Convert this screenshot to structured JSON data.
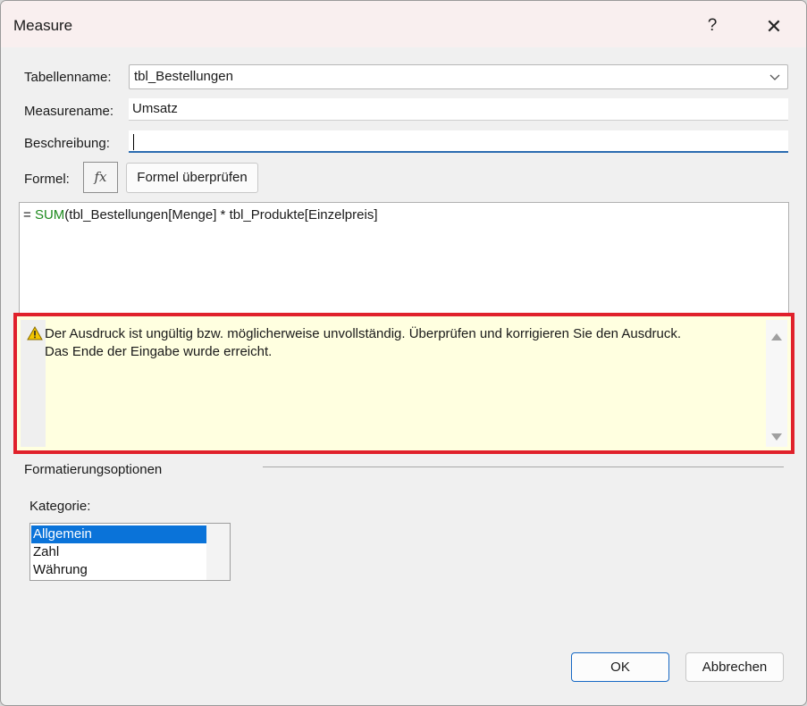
{
  "window": {
    "title": "Measure",
    "help_glyph": "?",
    "close_glyph": "✕"
  },
  "form": {
    "table_label": "Tabellenname:",
    "table_value": "tbl_Bestellungen",
    "measure_label": "Measurename:",
    "measure_value": "Umsatz",
    "description_label": "Beschreibung:",
    "description_value": "",
    "formula_label": "Formel:",
    "fx_label": "fx",
    "check_formula_button": "Formel überprüfen"
  },
  "formula": {
    "prefix": "= ",
    "function": "SUM",
    "rest": "(tbl_Bestellungen[Menge] * tbl_Produkte[Einzelpreis]"
  },
  "error": {
    "icon": "warning-icon",
    "line1": "Der Ausdruck ist ungültig bzw. möglicherweise unvollständig. Überprüfen und korrigieren Sie den Ausdruck.",
    "line2": "Das Ende der Eingabe wurde erreicht.",
    "highlight_color": "#e0212b"
  },
  "formatting": {
    "section_title": "Formatierungsoptionen",
    "category_label": "Kategorie:",
    "categories": [
      "Allgemein",
      "Zahl",
      "Währung"
    ],
    "selected": "Allgemein"
  },
  "buttons": {
    "ok": "OK",
    "cancel": "Abbrechen"
  },
  "colors": {
    "accent": "#0a73d9",
    "function_green": "#1e8a1e"
  }
}
